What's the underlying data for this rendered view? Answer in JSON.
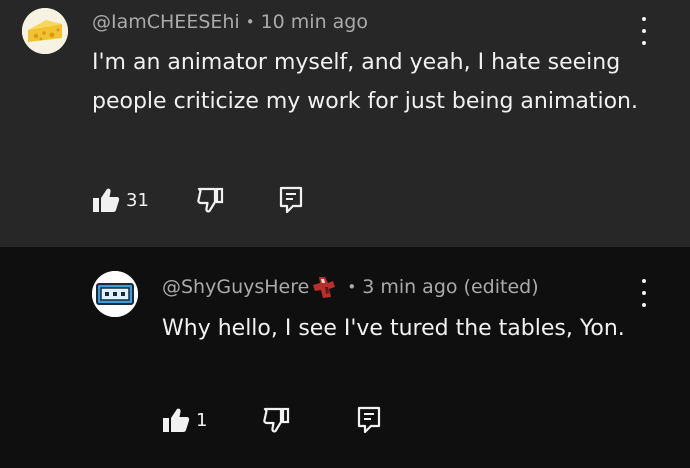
{
  "comments": [
    {
      "handle": "@IamCHEESEhi",
      "time": "10 min ago",
      "text": "I'm an animator myself, and yeah, I hate seeing people criticize my work for just being animation.",
      "likes": "31",
      "avatar_color": "#f7f3e2"
    },
    {
      "handle": "@ShyGuysHere",
      "time": "3 min ago (edited)",
      "text": "Why hello, I see I've tured the tables, Yon.",
      "likes": "1",
      "avatar_color": "#ffffff"
    }
  ],
  "separator": "•",
  "icons": {
    "like": "thumbs-up-icon",
    "dislike": "thumbs-down-icon",
    "reply": "reply-comment-icon",
    "menu": "more-vertical-icon"
  },
  "colors": {
    "top_bg": "#272727",
    "reply_bg": "#0f0f0f",
    "meta_text": "#aaaaaa",
    "body_text": "#f1f1f1"
  }
}
